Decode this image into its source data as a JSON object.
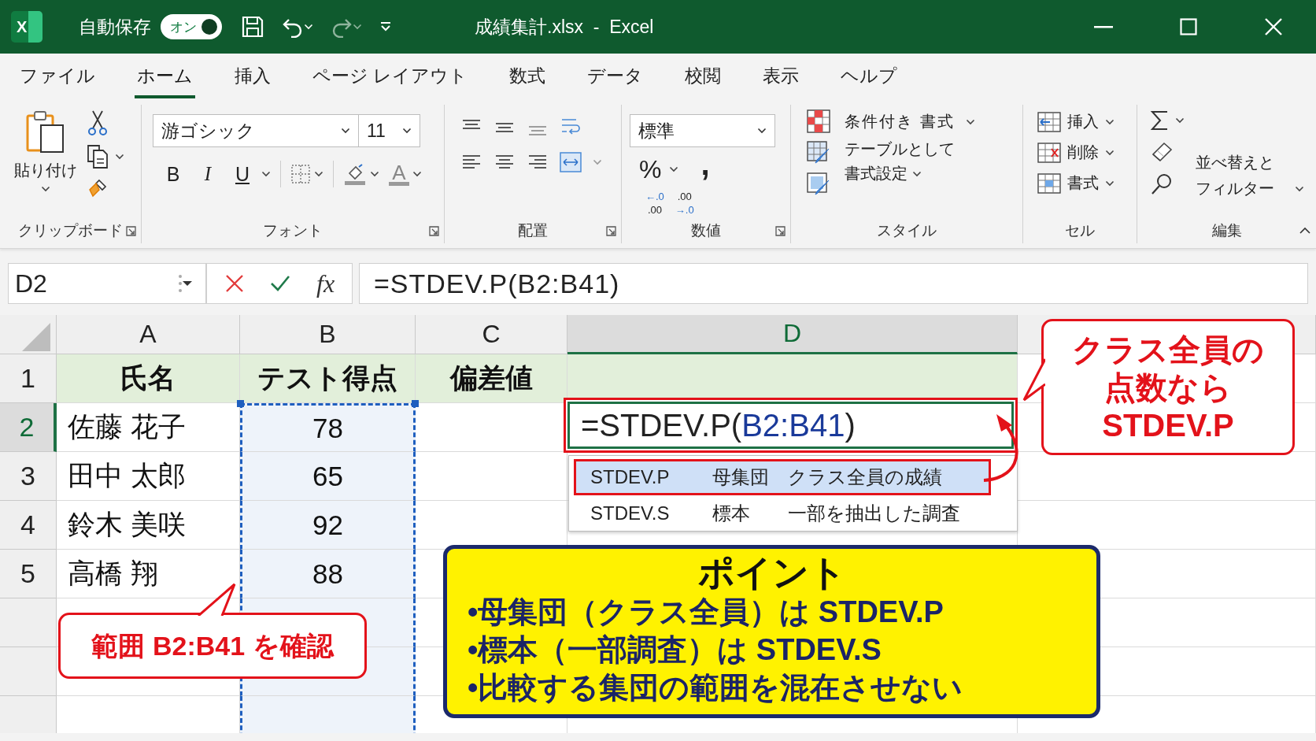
{
  "window": {
    "icon_letter": "X",
    "autosave": {
      "label": "自動保存",
      "toggle": "オン",
      "on": true
    },
    "title": "成績集計.xlsx  -  Excel"
  },
  "tabs": [
    {
      "label": "ファイル",
      "selected": false
    },
    {
      "label": "ホーム",
      "selected": true
    },
    {
      "label": "挿入",
      "selected": false
    },
    {
      "label": "ページ レイアウト",
      "selected": false
    },
    {
      "label": "数式",
      "selected": false
    },
    {
      "label": "データ",
      "selected": false
    },
    {
      "label": "校閲",
      "selected": false
    },
    {
      "label": "表示",
      "selected": false
    },
    {
      "label": "ヘルプ",
      "selected": false
    }
  ],
  "ribbon": {
    "clipboard": {
      "label": "クリップボード",
      "paste": "貼り付け"
    },
    "font": {
      "label": "フォント",
      "font_name": "游ゴシック",
      "font_size": "11",
      "bold": "B",
      "italic": "I",
      "underline": "U",
      "font_color": "A"
    },
    "alignment": {
      "label": "配置"
    },
    "number": {
      "label": "数値",
      "format": "標準",
      "percent": "%",
      "comma": ",",
      "increase_decimal": [
        "←.0",
        ".00"
      ],
      "decrease_decimal": [
        ".00",
        "→.0"
      ]
    },
    "styles": {
      "label": "スタイル",
      "items": [
        "条件付き 書式",
        "テーブルとして",
        "書式設定"
      ]
    },
    "cells": {
      "label": "セル",
      "items": [
        "挿入",
        "削除",
        "書式"
      ]
    },
    "editing": {
      "label": "編集",
      "sort_filter": [
        "並べ替えと",
        "フィルター"
      ]
    }
  },
  "formula_bar": {
    "name_box": "D2",
    "fx": "fx",
    "formula": "=STDEV.P(B2:B41)"
  },
  "sheet": {
    "columns": [
      {
        "label": "A",
        "selected": false,
        "referenced": false
      },
      {
        "label": "B",
        "selected": false,
        "referenced": true
      },
      {
        "label": "C",
        "selected": false,
        "referenced": false
      },
      {
        "label": "D",
        "selected": true,
        "referenced": false
      }
    ],
    "rows": [
      {
        "label": "1",
        "selected": false,
        "kind": "header",
        "cells": [
          "氏名",
          "テスト得点",
          "偏差値"
        ]
      },
      {
        "label": "2",
        "selected": true,
        "kind": "data",
        "cells": [
          "佐藤 花子",
          "78"
        ]
      },
      {
        "label": "3",
        "selected": false,
        "kind": "data",
        "cells": [
          "田中 太郎",
          "65"
        ]
      },
      {
        "label": "4",
        "selected": false,
        "kind": "data",
        "cells": [
          "鈴木 美咲",
          "92"
        ]
      },
      {
        "label": "5",
        "selected": false,
        "kind": "data",
        "cells": [
          "高橋 翔",
          "88"
        ]
      }
    ]
  },
  "formula_edit": {
    "function": "=STDEV.P(",
    "range": "B2:B41",
    "close": ")"
  },
  "autocomplete": [
    {
      "name": "STDEV.P",
      "category": "母集団",
      "description": "クラス全員の成績",
      "selected": true
    },
    {
      "name": "STDEV.S",
      "category": "標本",
      "description": "一部を抽出した調査",
      "selected": false
    }
  ],
  "callouts": [
    {
      "kind": "pointer-left",
      "lines": [
        "クラス全員の",
        "点数なら",
        "STDEV.P"
      ]
    },
    {
      "kind": "pointer-up",
      "lines": [
        "範囲 B2:B41 を確認"
      ]
    }
  ],
  "point_box": {
    "title": "ポイント",
    "bullets": [
      "•母集団（クラス全員）は STDEV.P",
      "•標本（一部調査）は STDEV.S",
      "•比較する集団の範囲を混在させない"
    ]
  }
}
